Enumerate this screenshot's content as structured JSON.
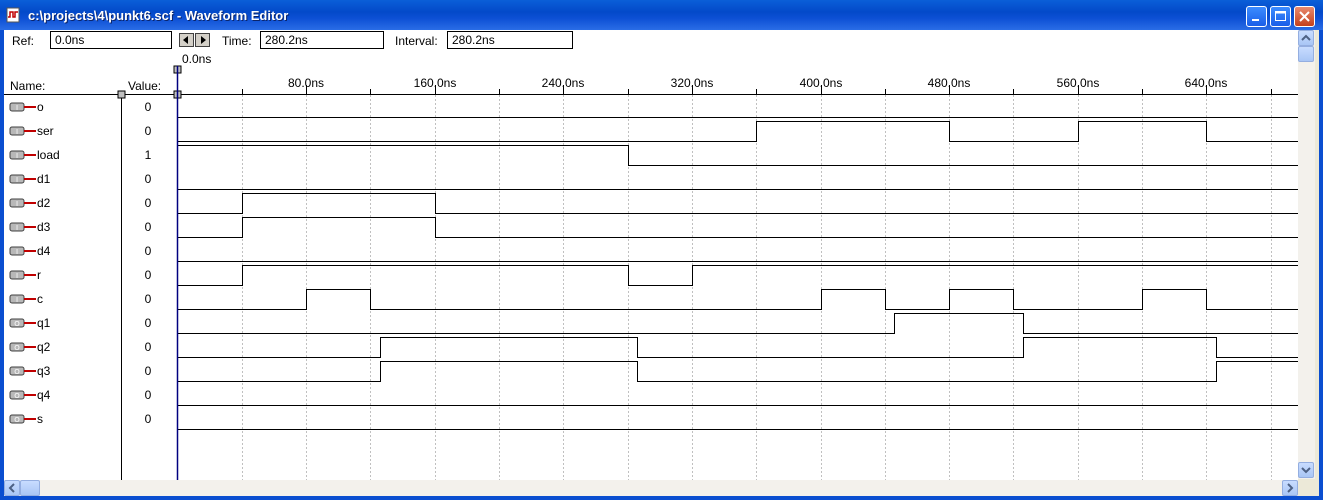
{
  "window": {
    "title": "c:\\projects\\4\\punkt6.scf - Waveform Editor"
  },
  "toolbar": {
    "ref_label": "Ref:",
    "ref_value": "0.0ns",
    "time_label": "Time:",
    "time_value": "280.2ns",
    "interval_label": "Interval:",
    "interval_value": "280.2ns"
  },
  "header": {
    "name_label": "Name:",
    "value_label": "Value:",
    "cursor_label": "0.0ns"
  },
  "timescale": {
    "labels": [
      "80.0ns",
      "160.0ns",
      "240.0ns",
      "320.0ns",
      "400.0ns",
      "480.0ns",
      "560.0ns",
      "640.0ns"
    ],
    "ns_per_major": 80
  },
  "signals": [
    {
      "name": "o",
      "value": "0",
      "type": "input",
      "wave": [
        0
      ]
    },
    {
      "name": "ser",
      "value": "0",
      "type": "input",
      "wave": [
        0,
        360,
        1,
        480,
        0,
        560,
        1,
        640,
        0
      ]
    },
    {
      "name": "load",
      "value": "1",
      "type": "input",
      "wave": [
        1,
        280,
        0
      ]
    },
    {
      "name": "d1",
      "value": "0",
      "type": "input",
      "wave": [
        0
      ]
    },
    {
      "name": "d2",
      "value": "0",
      "type": "input",
      "wave": [
        0,
        40,
        1,
        160,
        0
      ]
    },
    {
      "name": "d3",
      "value": "0",
      "type": "input",
      "wave": [
        0,
        40,
        1,
        160,
        0
      ]
    },
    {
      "name": "d4",
      "value": "0",
      "type": "input",
      "wave": [
        0
      ]
    },
    {
      "name": "r",
      "value": "0",
      "type": "input",
      "wave": [
        0,
        40,
        1,
        280,
        0,
        320,
        1
      ]
    },
    {
      "name": "c",
      "value": "0",
      "type": "input",
      "wave": [
        0,
        80,
        1,
        120,
        0,
        400,
        1,
        440,
        0,
        480,
        1,
        520,
        0,
        600,
        1,
        640,
        0
      ]
    },
    {
      "name": "q1",
      "value": "0",
      "type": "output",
      "wave": [
        0,
        446,
        1,
        526,
        0
      ]
    },
    {
      "name": "q2",
      "value": "0",
      "type": "output",
      "wave": [
        0,
        126,
        1,
        286,
        0,
        526,
        1,
        646,
        0
      ]
    },
    {
      "name": "q3",
      "value": "0",
      "type": "output",
      "wave": [
        0,
        126,
        1,
        286,
        0,
        646,
        1
      ]
    },
    {
      "name": "q4",
      "value": "0",
      "type": "output",
      "wave": [
        0
      ]
    },
    {
      "name": "s",
      "value": "0",
      "type": "output",
      "wave": [
        0
      ]
    }
  ],
  "colors": {
    "title_bar": "#0a5fd8",
    "cursor_line": "#000080",
    "pin_red": "#c00000",
    "grid": "#c0c0c0"
  },
  "icons": {
    "app": "waveform-doc-icon",
    "minimize": "minimize-icon",
    "maximize": "maximize-icon",
    "close": "close-icon",
    "ref_left": "arrow-left-icon",
    "ref_right": "arrow-right-icon"
  }
}
